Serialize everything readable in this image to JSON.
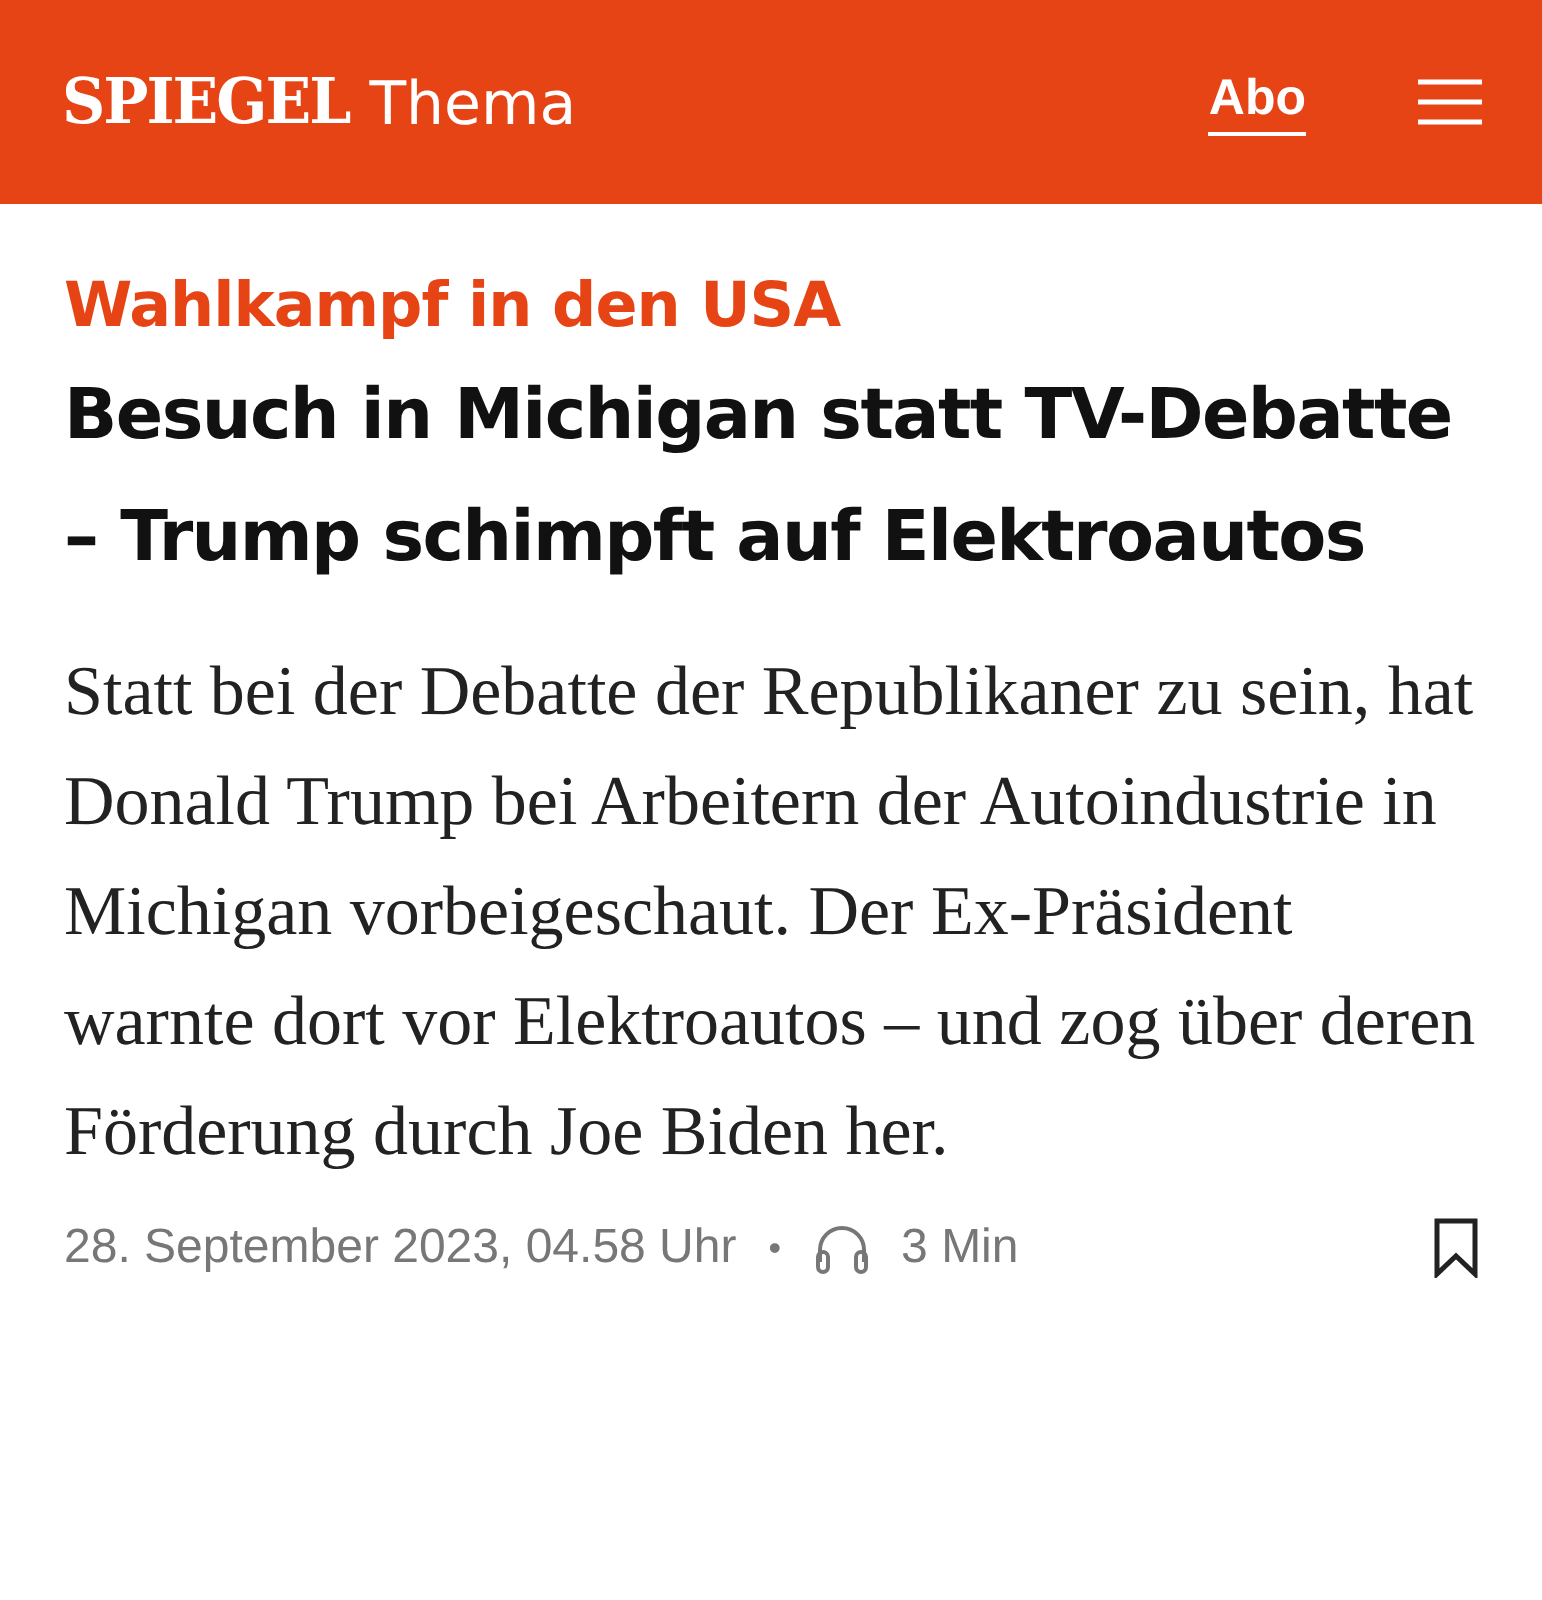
{
  "header": {
    "brand": "SPIEGEL",
    "section": "Thema",
    "abo": "Abo"
  },
  "article": {
    "kicker": "Wahlkampf in den USA",
    "headline": "Besuch in Michigan statt TV-Debatte – Trump schimpft auf Elektroautos",
    "teaser": "Statt bei der Debatte der Republikaner zu sein, hat Donald Trump bei Arbeitern der Autoindustrie in Michigan vorbeigeschaut. Der Ex-Präsident warnte dort vor Elektroautos – und zog über deren Förderung durch Joe Biden her.",
    "date": "28. September 2023, 04.58 Uhr",
    "separator": "•",
    "duration": "3 Min"
  }
}
